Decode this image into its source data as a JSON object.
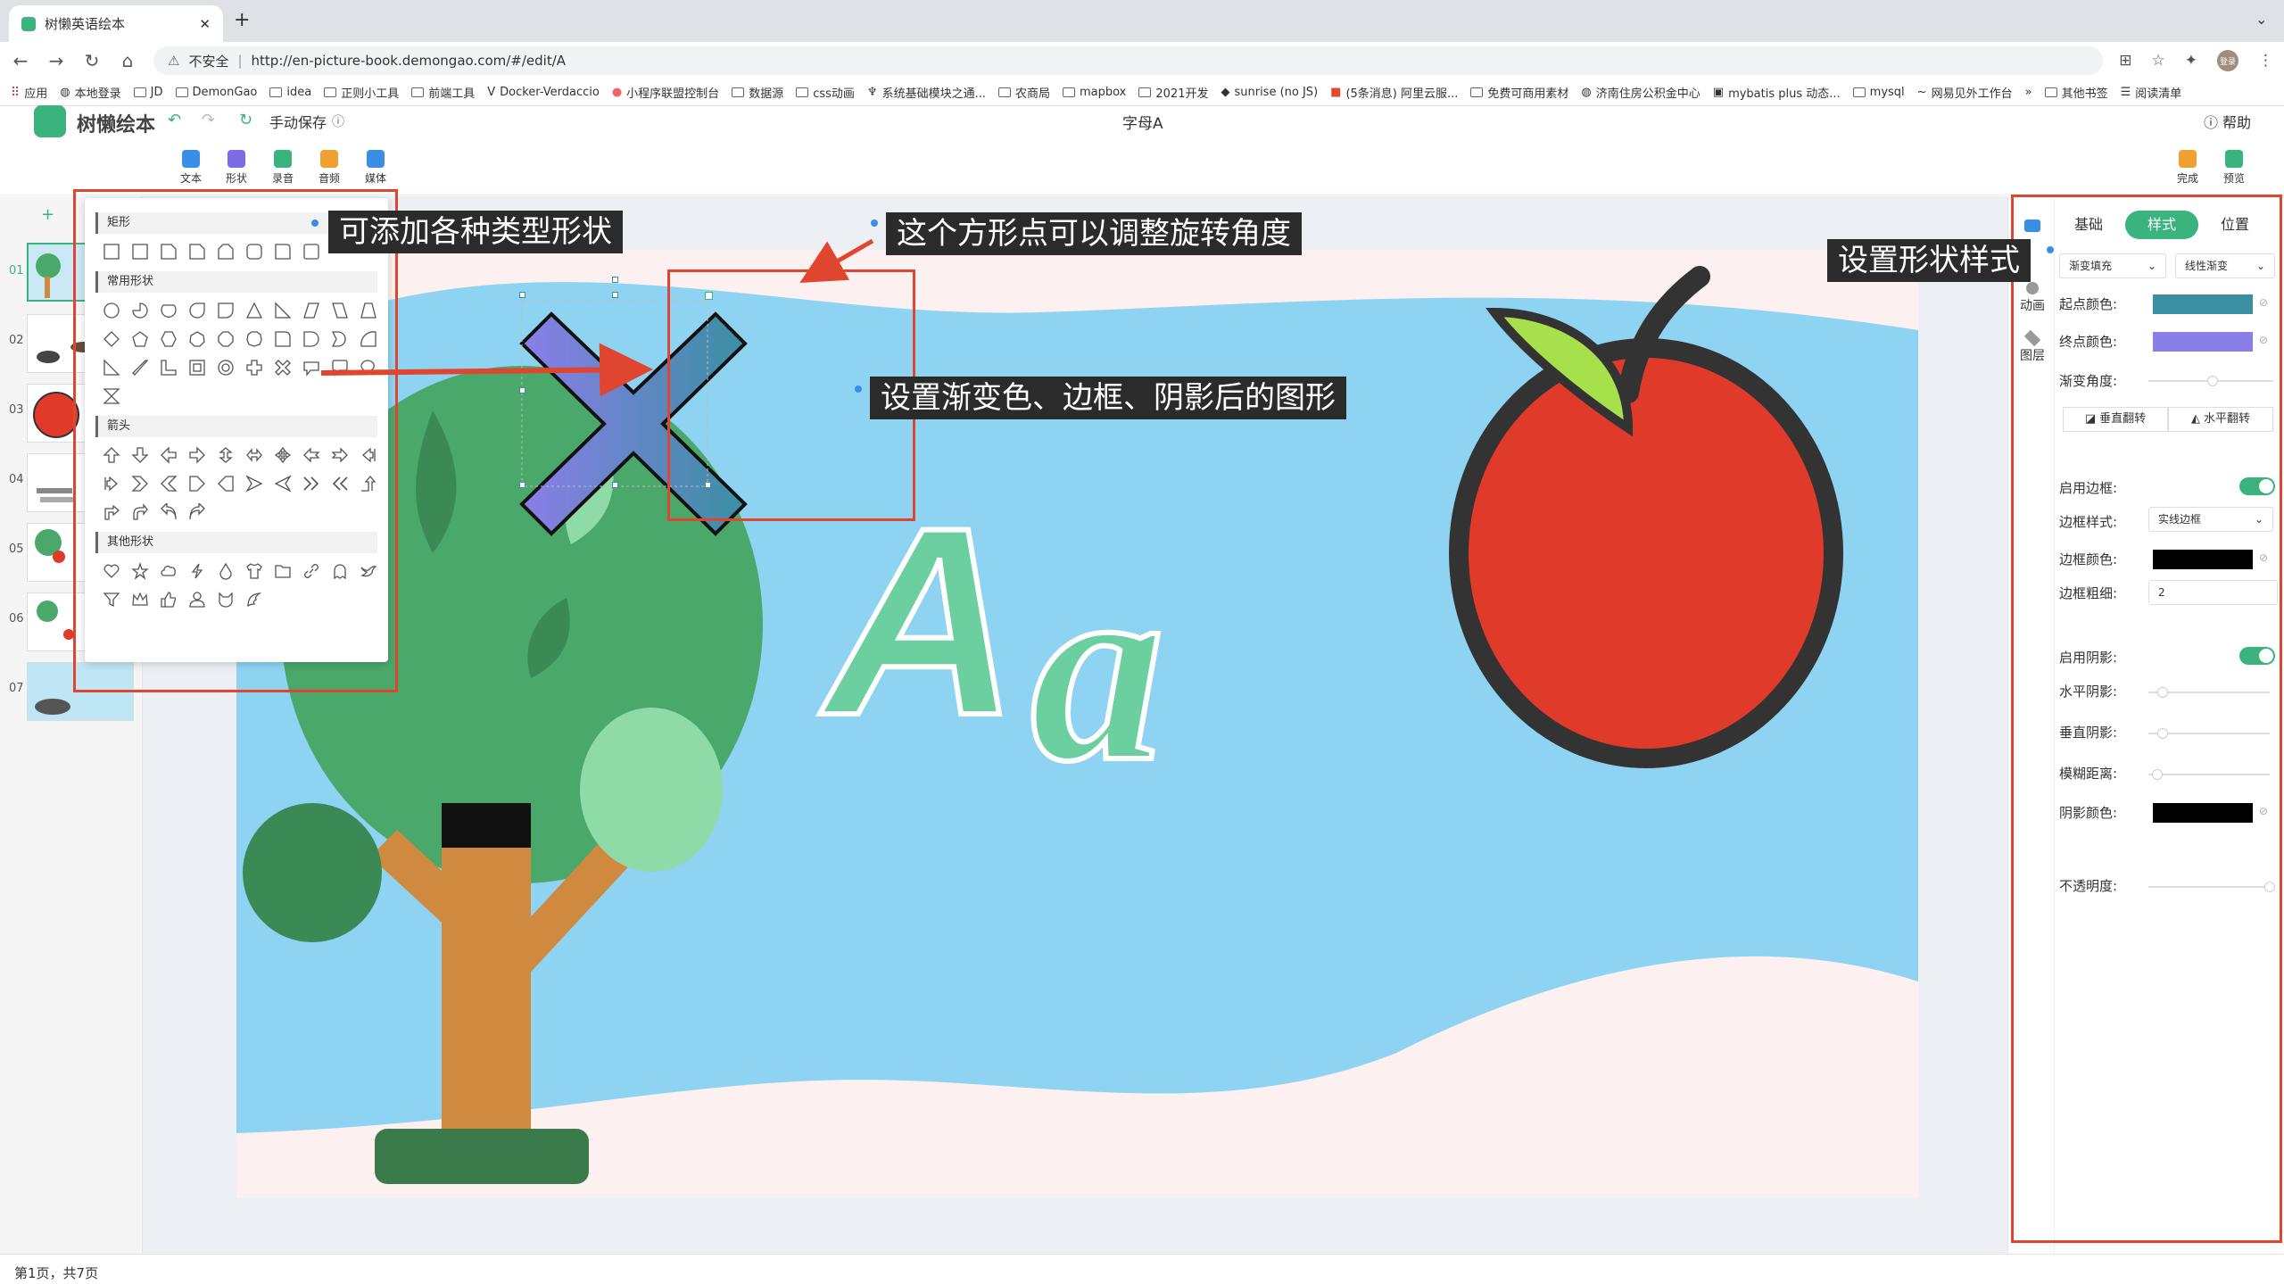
{
  "browser": {
    "tab_title": "树懒英语绘本",
    "url_warning": "不安全",
    "url": "http://en-picture-book.demongao.com/#/edit/A",
    "avatar_text": "登录",
    "bookmarks": [
      "应用",
      "本地登录",
      "JD",
      "DemonGao",
      "idea",
      "正则小工具",
      "前端工具",
      "Docker-Verdaccio",
      "小程序联盟控制台",
      "数据源",
      "css动画",
      "系统基础模块之通...",
      "农商局",
      "mapbox",
      "2021开发",
      "sunrise (no JS)",
      "(5条消息) 阿里云服...",
      "免费可商用素材",
      "济南住房公积金中心",
      "mybatis plus 动态...",
      "mysql",
      "网易见外工作台"
    ],
    "bookmarks_more": "»",
    "bookmarks_other": "其他书签",
    "reading_list": "阅读清单"
  },
  "app": {
    "brand": "树懒绘本",
    "save_mode": "手动保存",
    "doc_title": "字母A",
    "help": "帮助",
    "toolbar": [
      {
        "label": "文本",
        "color": "#3a8ee6"
      },
      {
        "label": "形状",
        "color": "#7b6ce6"
      },
      {
        "label": "录音",
        "color": "#3bb37f"
      },
      {
        "label": "音频",
        "color": "#f0a030"
      },
      {
        "label": "媒体",
        "color": "#3a8ee6"
      }
    ],
    "done": "完成",
    "preview": "预览"
  },
  "pages": {
    "add": "+",
    "items": [
      "01",
      "02",
      "03",
      "04",
      "05",
      "06",
      "07"
    ],
    "status": "第1页，共7页"
  },
  "shape_panel": {
    "sections": [
      {
        "title": "矩形",
        "count": 8
      },
      {
        "title": "常用形状",
        "count": 32
      },
      {
        "title": "箭头",
        "count": 23
      },
      {
        "title": "其他形状",
        "count": 16
      }
    ]
  },
  "canvas": {
    "letter_upper": "A",
    "letter_lower": "a",
    "brand_color": "#3bb37f"
  },
  "right_panel": {
    "tabs": [
      "基础",
      "样式",
      "位置"
    ],
    "active_tab": "样式",
    "side_nav": [
      "动画",
      "图层"
    ],
    "fill_mode": "渐变填充",
    "gradient_type": "线性渐变",
    "start_color_label": "起点颜色:",
    "start_color": "#3b8fa3",
    "end_color_label": "终点颜色:",
    "end_color": "#8a7ee8",
    "gradient_angle_label": "渐变角度:",
    "flip_vertical": "垂直翻转",
    "flip_horizontal": "水平翻转",
    "border_enable_label": "启用边框:",
    "border_style_label": "边框样式:",
    "border_style": "实线边框",
    "border_color_label": "边框颜色:",
    "border_color": "#000000",
    "border_width_label": "边框粗细:",
    "border_width": "2",
    "shadow_enable_label": "启用阴影:",
    "shadow_h_label": "水平阴影:",
    "shadow_v_label": "垂直阴影:",
    "shadow_blur_label": "模糊距离:",
    "shadow_color_label": "阴影颜色:",
    "shadow_color": "#000000",
    "opacity_label": "不透明度:"
  },
  "annotations": {
    "shapes": "可添加各种类型形状",
    "rotate": "这个方形点可以调整旋转角度",
    "result": "设置渐变色、边框、阴影后的图形",
    "style": "设置形状样式"
  }
}
